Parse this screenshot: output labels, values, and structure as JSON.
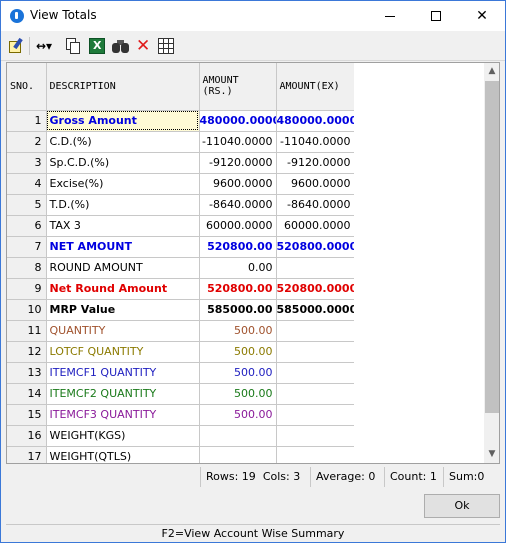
{
  "window": {
    "title": "View Totals",
    "controls": {
      "minimize": "",
      "maximize": "",
      "close": "✕"
    }
  },
  "toolbar": {
    "items": [
      {
        "name": "edit-icon",
        "label": ""
      },
      {
        "name": "column-resize-icon",
        "label": "↔▾"
      },
      {
        "name": "copy-icon",
        "label": ""
      },
      {
        "name": "excel-icon",
        "label": ""
      },
      {
        "name": "find-icon",
        "label": ""
      },
      {
        "name": "delete-icon",
        "label": "✕"
      },
      {
        "name": "grid-icon",
        "label": ""
      }
    ]
  },
  "grid": {
    "headers": {
      "sno": "SNO.",
      "desc": "DESCRIPTION",
      "amt": "AMOUNT (RS.)",
      "ex": "AMOUNT(EX)"
    },
    "rows": [
      {
        "sno": "1",
        "desc": "Gross Amount",
        "amt": "480000.0000",
        "ex": "480000.0000"
      },
      {
        "sno": "2",
        "desc": "C.D.(%)",
        "amt": "-11040.0000",
        "ex": "-11040.0000"
      },
      {
        "sno": "3",
        "desc": "Sp.C.D.(%)",
        "amt": "-9120.0000",
        "ex": "-9120.0000"
      },
      {
        "sno": "4",
        "desc": "Excise(%)",
        "amt": "9600.0000",
        "ex": "9600.0000"
      },
      {
        "sno": "5",
        "desc": "T.D.(%)",
        "amt": "-8640.0000",
        "ex": "-8640.0000"
      },
      {
        "sno": "6",
        "desc": "TAX 3",
        "amt": "60000.0000",
        "ex": "60000.0000"
      },
      {
        "sno": "7",
        "desc": "NET AMOUNT",
        "amt": "520800.00",
        "ex": "520800.0000"
      },
      {
        "sno": "8",
        "desc": "ROUND AMOUNT",
        "amt": "0.00",
        "ex": ""
      },
      {
        "sno": "9",
        "desc": "Net Round Amount",
        "amt": "520800.00",
        "ex": "520800.0000"
      },
      {
        "sno": "10",
        "desc": "MRP Value",
        "amt": "585000.00",
        "ex": "585000.0000"
      },
      {
        "sno": "11",
        "desc": "QUANTITY",
        "amt": "500.00",
        "ex": ""
      },
      {
        "sno": "12",
        "desc": "LOTCF    QUANTITY",
        "amt": "500.00",
        "ex": ""
      },
      {
        "sno": "13",
        "desc": "ITEMCF1   QUANTITY",
        "amt": "500.00",
        "ex": ""
      },
      {
        "sno": "14",
        "desc": "ITEMCF2   QUANTITY",
        "amt": "500.00",
        "ex": ""
      },
      {
        "sno": "15",
        "desc": "ITEMCF3    QUANTITY",
        "amt": "500.00",
        "ex": ""
      },
      {
        "sno": "16",
        "desc": "WEIGHT(KGS)",
        "amt": "",
        "ex": ""
      },
      {
        "sno": "17",
        "desc": "WEIGHT(QTLS)",
        "amt": "",
        "ex": ""
      }
    ],
    "colors": {
      "blue": "#0000e0",
      "red": "#e00000",
      "brown": "#a0522d",
      "olive": "#8b7a00",
      "navy": "#2020c0",
      "green": "#1a7a1a",
      "purple": "#8a1a9a"
    }
  },
  "scrollbar": {
    "up": "▲",
    "down": "▼"
  },
  "status": {
    "rows": "Rows: 19",
    "cols": "Cols: 3",
    "average": "Average: 0",
    "count": "Count: 1",
    "sum": "Sum:0"
  },
  "buttons": {
    "ok": "Ok"
  },
  "footer": {
    "hint": "F2=View Account Wise Summary"
  }
}
